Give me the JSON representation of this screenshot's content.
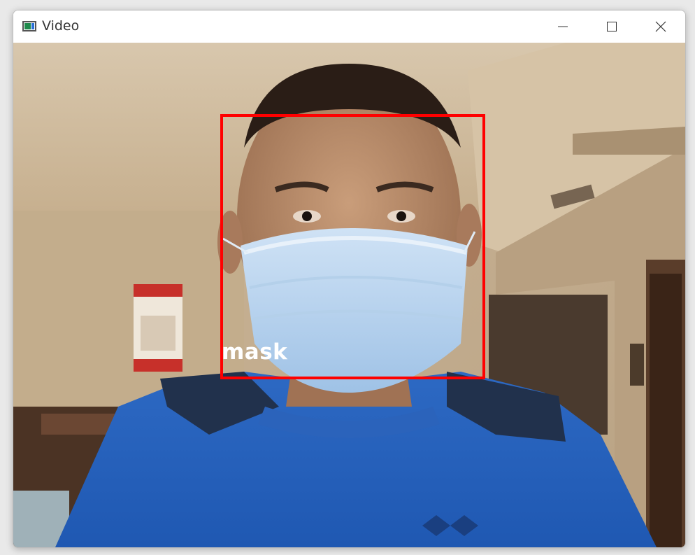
{
  "window": {
    "title": "Video",
    "icon": "video-window-icon",
    "controls": [
      "minimize-icon",
      "maximize-icon",
      "close-icon"
    ]
  },
  "detection": {
    "label": "mask",
    "box_color": "#ff0000"
  }
}
